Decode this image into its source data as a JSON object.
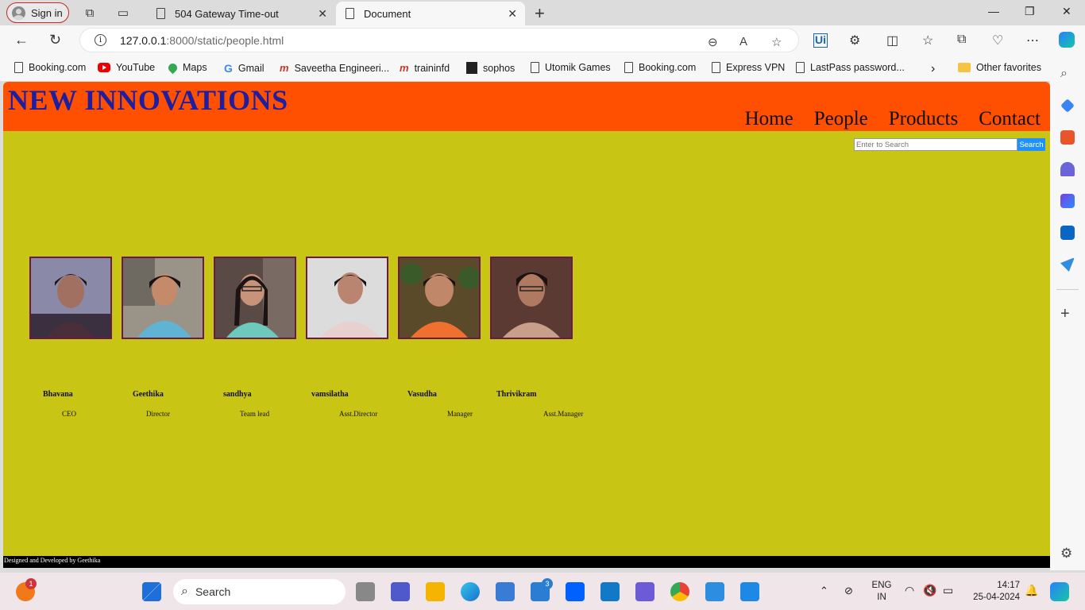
{
  "browser": {
    "signin_label": "Sign in",
    "tabs": [
      {
        "title": "504 Gateway Time-out",
        "active": false
      },
      {
        "title": "Document",
        "active": true
      }
    ],
    "url_host": "127.0.0.1",
    "url_path": ":8000/static/people.html",
    "favorites": [
      {
        "label": "Booking.com",
        "icon": "doc-icon"
      },
      {
        "label": "YouTube",
        "icon": "youtube-icon"
      },
      {
        "label": "Maps",
        "icon": "maps-icon"
      },
      {
        "label": "Gmail",
        "icon": "google-icon"
      },
      {
        "label": "Saveetha Engineeri...",
        "icon": "m-icon"
      },
      {
        "label": "traininfd",
        "icon": "m-icon"
      },
      {
        "label": "sophos",
        "icon": "sophos-icon"
      },
      {
        "label": "Utomik Games",
        "icon": "doc-icon"
      },
      {
        "label": "Booking.com",
        "icon": "doc-icon"
      },
      {
        "label": "Express VPN",
        "icon": "doc-icon"
      },
      {
        "label": "LastPass password...",
        "icon": "doc-icon"
      }
    ],
    "other_favorites": "Other favorites"
  },
  "site": {
    "brand": "NEW INNOVATIONS",
    "nav": [
      "Home",
      "People",
      "Products",
      "Contact"
    ],
    "search_placeholder": "Enter to Search",
    "search_button": "Search",
    "people": [
      {
        "name": "Bhavana",
        "role": "CEO"
      },
      {
        "name": "Geethika",
        "role": "Director"
      },
      {
        "name": "sandhya",
        "role": "Team lead"
      },
      {
        "name": "vamsilatha",
        "role": "Asst.Director"
      },
      {
        "name": "Vasudha",
        "role": "Manager"
      },
      {
        "name": "Thrivikram",
        "role": "Asst.Manager"
      }
    ],
    "footer": "Designed and Developed by Geethika",
    "colors": {
      "header": "#ff4f00",
      "page": "#c9c515",
      "brand": "#1e1ea0",
      "footer": "#000000"
    }
  },
  "taskbar": {
    "search_label": "Search",
    "lang_line1": "ENG",
    "lang_line2": "IN",
    "time": "14:17",
    "date": "25-04-2024",
    "mail_badge": "3",
    "notif_badge": "1"
  }
}
